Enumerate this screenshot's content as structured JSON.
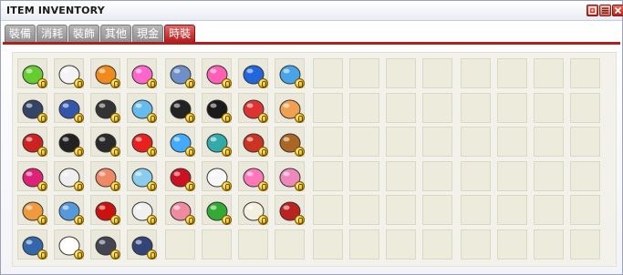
{
  "window": {
    "title": "ITEM INVENTORY"
  },
  "titlebar_buttons": [
    "help-icon",
    "menu-icon",
    "close-icon"
  ],
  "tabs": [
    {
      "label": "裝備",
      "active": false
    },
    {
      "label": "消耗",
      "active": false
    },
    {
      "label": "裝飾",
      "active": false
    },
    {
      "label": "其他",
      "active": false
    },
    {
      "label": "現金",
      "active": false
    },
    {
      "label": "時裝",
      "active": true
    }
  ],
  "inventory": {
    "columns": 16,
    "rows": 6,
    "items": [
      {
        "name": "green-slime-hat-icon",
        "color": "#66cc33"
      },
      {
        "name": "white-spiky-hair-icon",
        "color": "#f4f4f4"
      },
      {
        "name": "orange-mask-icon",
        "color": "#f08a1c"
      },
      {
        "name": "pink-headband-icon",
        "color": "#ff66cc"
      },
      {
        "name": "blue-jeans-icon",
        "color": "#6e8fc7"
      },
      {
        "name": "pink-skirt-icon",
        "color": "#ff5fb4"
      },
      {
        "name": "blue-shoes-icon",
        "color": "#2266dd"
      },
      {
        "name": "blue-pacifier-icon",
        "color": "#4aa3e8"
      },
      {
        "name": "police-cap-icon",
        "color": "#334466"
      },
      {
        "name": "blue-pet-hat-icon",
        "color": "#3355aa"
      },
      {
        "name": "black-beret-icon",
        "color": "#333333"
      },
      {
        "name": "bunny-ear-glasses-icon",
        "color": "#66bbee"
      },
      {
        "name": "black-shoes-icon",
        "color": "#222222"
      },
      {
        "name": "black-boots-icon",
        "color": "#1a1a1a"
      },
      {
        "name": "red-sneakers-icon",
        "color": "#dd3333"
      },
      {
        "name": "orange-doll-face-icon",
        "color": "#f0a050"
      },
      {
        "name": "red-helmet-icon",
        "color": "#cc2222"
      },
      {
        "name": "black-headphones-icon",
        "color": "#222222"
      },
      {
        "name": "black-coat-icon",
        "color": "#2a2a2a"
      },
      {
        "name": "heart-tshirt-icon",
        "color": "#e82020"
      },
      {
        "name": "blue-crystal-wings-icon",
        "color": "#44aaff"
      },
      {
        "name": "teal-backpack-icon",
        "color": "#33aaaa"
      },
      {
        "name": "red-snail-shell-icon",
        "color": "#cc3322"
      },
      {
        "name": "wooden-slingshot-icon",
        "color": "#aa6622"
      },
      {
        "name": "pink-black-vest-icon",
        "color": "#dd2277"
      },
      {
        "name": "white-shirt-icon",
        "color": "#eeeeee"
      },
      {
        "name": "striped-sweater-icon",
        "color": "#ee8866"
      },
      {
        "name": "light-blue-jacket-icon",
        "color": "#88ccee"
      },
      {
        "name": "red-rose-icon",
        "color": "#cc1122"
      },
      {
        "name": "white-duck-icon",
        "color": "#f7f7f7"
      },
      {
        "name": "pink-heart-balloon-icon",
        "color": "#ff77bb"
      },
      {
        "name": "pink-flower-wand-icon",
        "color": "#ee88bb"
      },
      {
        "name": "orange-tank-top-icon",
        "color": "#f09a40"
      },
      {
        "name": "blue-balloon-outfit-icon",
        "color": "#5599dd"
      },
      {
        "name": "red-dress-icon",
        "color": "#cc1111"
      },
      {
        "name": "white-ruffle-shirt-icon",
        "color": "#f0f0f0"
      },
      {
        "name": "pink-bandage-icon",
        "color": "#f08aa0"
      },
      {
        "name": "green-snake-icon",
        "color": "#33aa33"
      },
      {
        "name": "white-wings-icon",
        "color": "#f4f0e0"
      },
      {
        "name": "red-coat-icon",
        "color": "#bb2222"
      },
      {
        "name": "blue-overalls-icon",
        "color": "#3366aa"
      },
      {
        "name": "sailor-uniform-icon",
        "color": "#ffffff"
      },
      {
        "name": "black-suit-icon",
        "color": "#444455"
      },
      {
        "name": "navy-shorts-icon",
        "color": "#334477"
      }
    ]
  }
}
